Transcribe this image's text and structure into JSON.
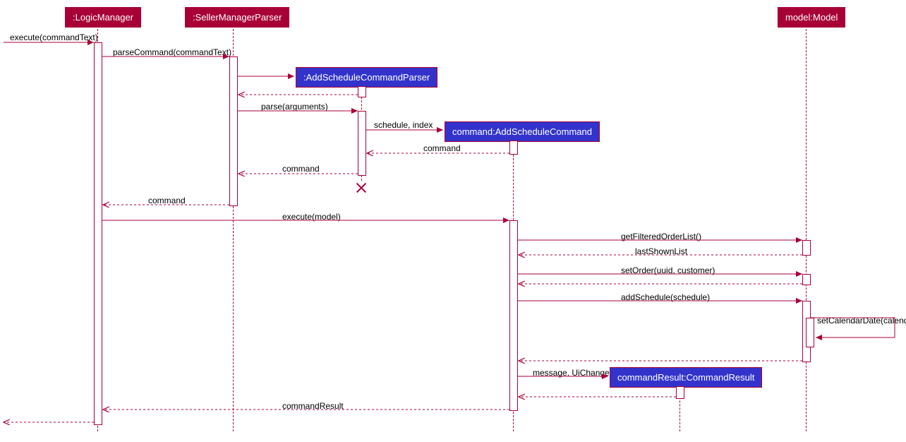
{
  "participants": {
    "logicManager": ":LogicManager",
    "sellerManagerParser": ":SellerManagerParser",
    "addScheduleCommandParser": ":AddScheduleCommandParser",
    "addScheduleCommand": "command:AddScheduleCommand",
    "commandResult": "commandResult:CommandResult",
    "model": "model:Model"
  },
  "messages": {
    "executeCommandText": "execute(commandText)",
    "parseCommand": "parseCommand(commandText)",
    "parseArguments": "parse(arguments)",
    "scheduleIndex": "schedule, index",
    "commandReturn1": "command",
    "commandReturn2": "command",
    "commandReturn3": "command",
    "executeModel": "execute(model)",
    "getFilteredOrderList": "getFilteredOrderList()",
    "lastShownList": "lastShownList",
    "setOrder": "setOrder(uuid, customer)",
    "addSchedule": "addSchedule(schedule)",
    "setCalendarDate": "setCalendarDate(calendar)",
    "messageUiChange": "message, UiChange",
    "commandResultReturn": "commandResult"
  }
}
